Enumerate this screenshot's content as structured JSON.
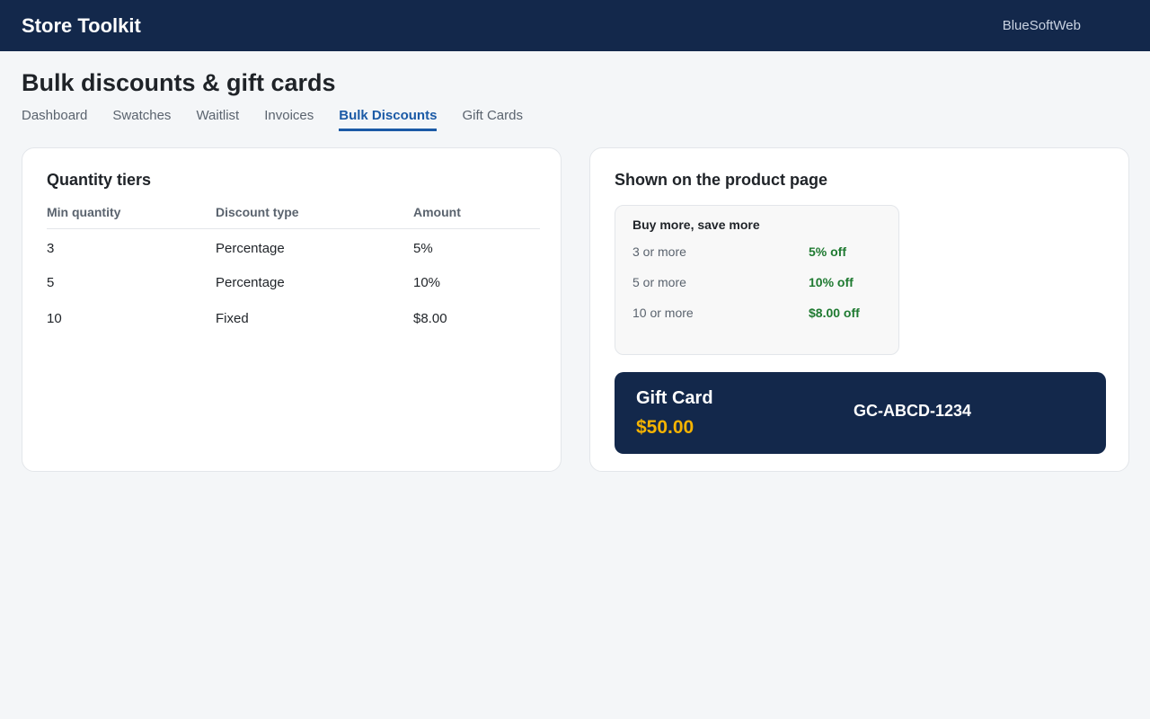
{
  "header": {
    "app_title": "Store Toolkit",
    "account_name": "BlueSoftWeb"
  },
  "page": {
    "title": "Bulk discounts & gift cards"
  },
  "tabs": [
    {
      "label": "Dashboard",
      "active": false
    },
    {
      "label": "Swatches",
      "active": false
    },
    {
      "label": "Waitlist",
      "active": false
    },
    {
      "label": "Invoices",
      "active": false
    },
    {
      "label": "Bulk Discounts",
      "active": true
    },
    {
      "label": "Gift Cards",
      "active": false
    }
  ],
  "tiers_card": {
    "title": "Quantity tiers",
    "columns": [
      "Min quantity",
      "Discount type",
      "Amount"
    ],
    "rows": [
      {
        "min_quantity": "3",
        "discount_type": "Percentage",
        "amount": "5%"
      },
      {
        "min_quantity": "5",
        "discount_type": "Percentage",
        "amount": "10%"
      },
      {
        "min_quantity": "10",
        "discount_type": "Fixed",
        "amount": "$8.00"
      }
    ]
  },
  "preview_card": {
    "title": "Shown on the product page",
    "widget_title": "Buy more, save more",
    "rows": [
      {
        "qty": "3 or more",
        "off": "5% off"
      },
      {
        "qty": "5 or more",
        "off": "10% off"
      },
      {
        "qty": "10 or more",
        "off": "$8.00 off"
      }
    ]
  },
  "gift_card": {
    "label": "Gift Card",
    "amount": "$50.00",
    "code": "GC-ABCD-1234"
  },
  "colors": {
    "header_bg": "#13284b",
    "accent": "#1b5aa6",
    "discount_green": "#1f7a31",
    "gift_amount": "#f5b301"
  }
}
